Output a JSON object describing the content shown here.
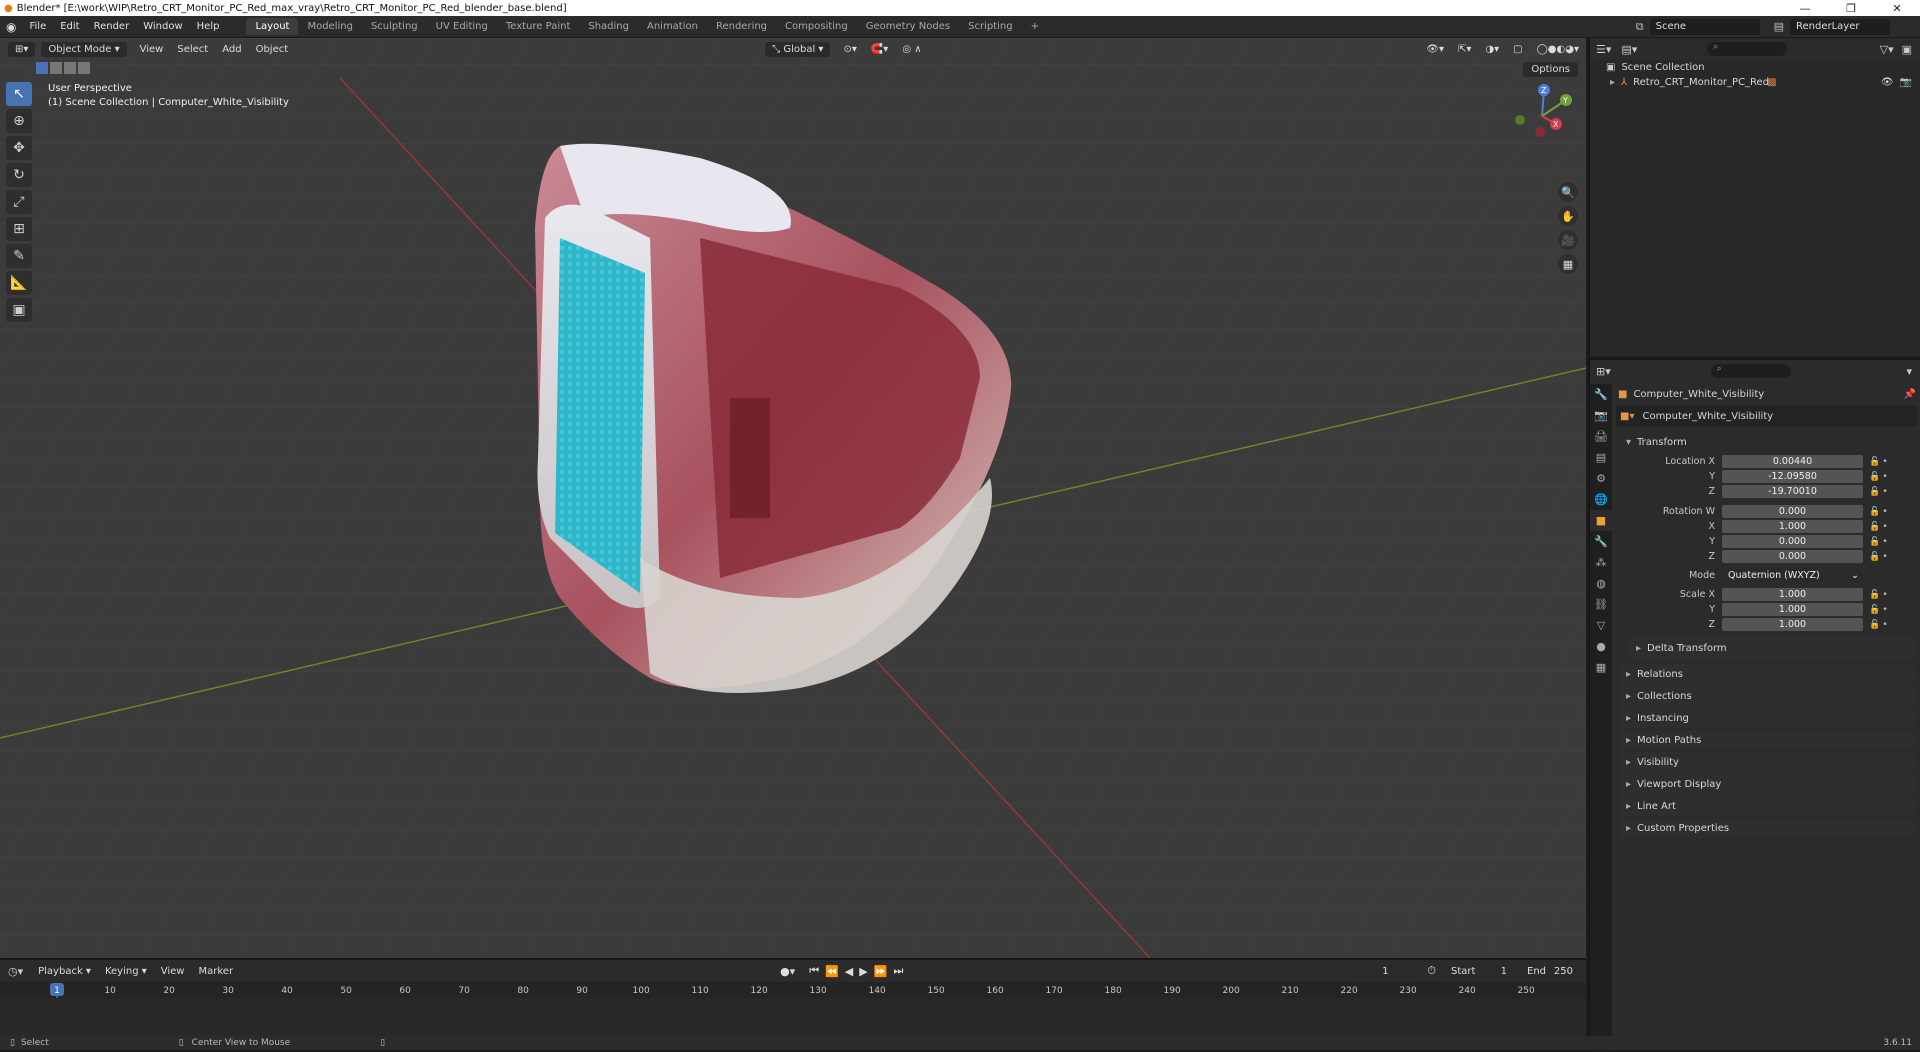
{
  "window": {
    "title": "Blender* [E:\\work\\WIP\\Retro_CRT_Monitor_PC_Red_max_vray\\Retro_CRT_Monitor_PC_Red_blender_base.blend]",
    "minimize": "—",
    "maximize": "❐",
    "close": "✕"
  },
  "menu": [
    "File",
    "Edit",
    "Render",
    "Window",
    "Help"
  ],
  "workspaces": [
    "Layout",
    "Modeling",
    "Sculpting",
    "UV Editing",
    "Texture Paint",
    "Shading",
    "Animation",
    "Rendering",
    "Compositing",
    "Geometry Nodes",
    "Scripting"
  ],
  "workspace_add": "+",
  "scene": {
    "name": "Scene",
    "view_layer": "RenderLayer"
  },
  "viewport": {
    "mode": "Object Mode",
    "menus": [
      "View",
      "Select",
      "Add",
      "Object"
    ],
    "orientation": "Global",
    "options_label": "Options",
    "perspective_label": "User Perspective",
    "collection_label": "(1) Scene Collection | Computer_White_Visibility",
    "gizmo_axes": {
      "x": "X",
      "y": "Y",
      "z": "Z"
    }
  },
  "outliner": {
    "root": "Scene Collection",
    "items": [
      {
        "label": "Retro_CRT_Monitor_PC_Red"
      }
    ]
  },
  "properties": {
    "object_name": "Computer_White_Visibility",
    "data_name": "Computer_White_Visibility",
    "transform_label": "Transform",
    "location": {
      "label": "Location X",
      "x": "0.00440",
      "y": "-12.09580",
      "z": "-19.70010"
    },
    "rotation": {
      "label": "Rotation W",
      "w": "0.000",
      "x": "1.000",
      "y": "0.000",
      "z": "0.000"
    },
    "mode_label": "Mode",
    "mode_value": "Quaternion (WXYZ)",
    "scale": {
      "label": "Scale X",
      "x": "1.000",
      "y": "1.000",
      "z": "1.000"
    },
    "axis_labels": {
      "y": "Y",
      "z": "Z",
      "x": "X"
    },
    "delta_label": "Delta Transform",
    "panels": [
      "Relations",
      "Collections",
      "Instancing",
      "Motion Paths",
      "Visibility",
      "Viewport Display",
      "Line Art",
      "Custom Properties"
    ]
  },
  "timeline": {
    "menus": [
      "Playback",
      "Keying",
      "View",
      "Marker"
    ],
    "current_frame": "1",
    "start_label": "Start",
    "start": "1",
    "end_label": "End",
    "end": "250",
    "ticks": [
      "10",
      "20",
      "30",
      "40",
      "50",
      "60",
      "70",
      "80",
      "90",
      "100",
      "110",
      "120",
      "130",
      "140",
      "150",
      "160",
      "170",
      "180",
      "190",
      "200",
      "210",
      "220",
      "230",
      "240",
      "250"
    ],
    "playhead": "1"
  },
  "status": {
    "select": "Select",
    "center_view": "Center View to Mouse",
    "version": "3.6.11"
  }
}
